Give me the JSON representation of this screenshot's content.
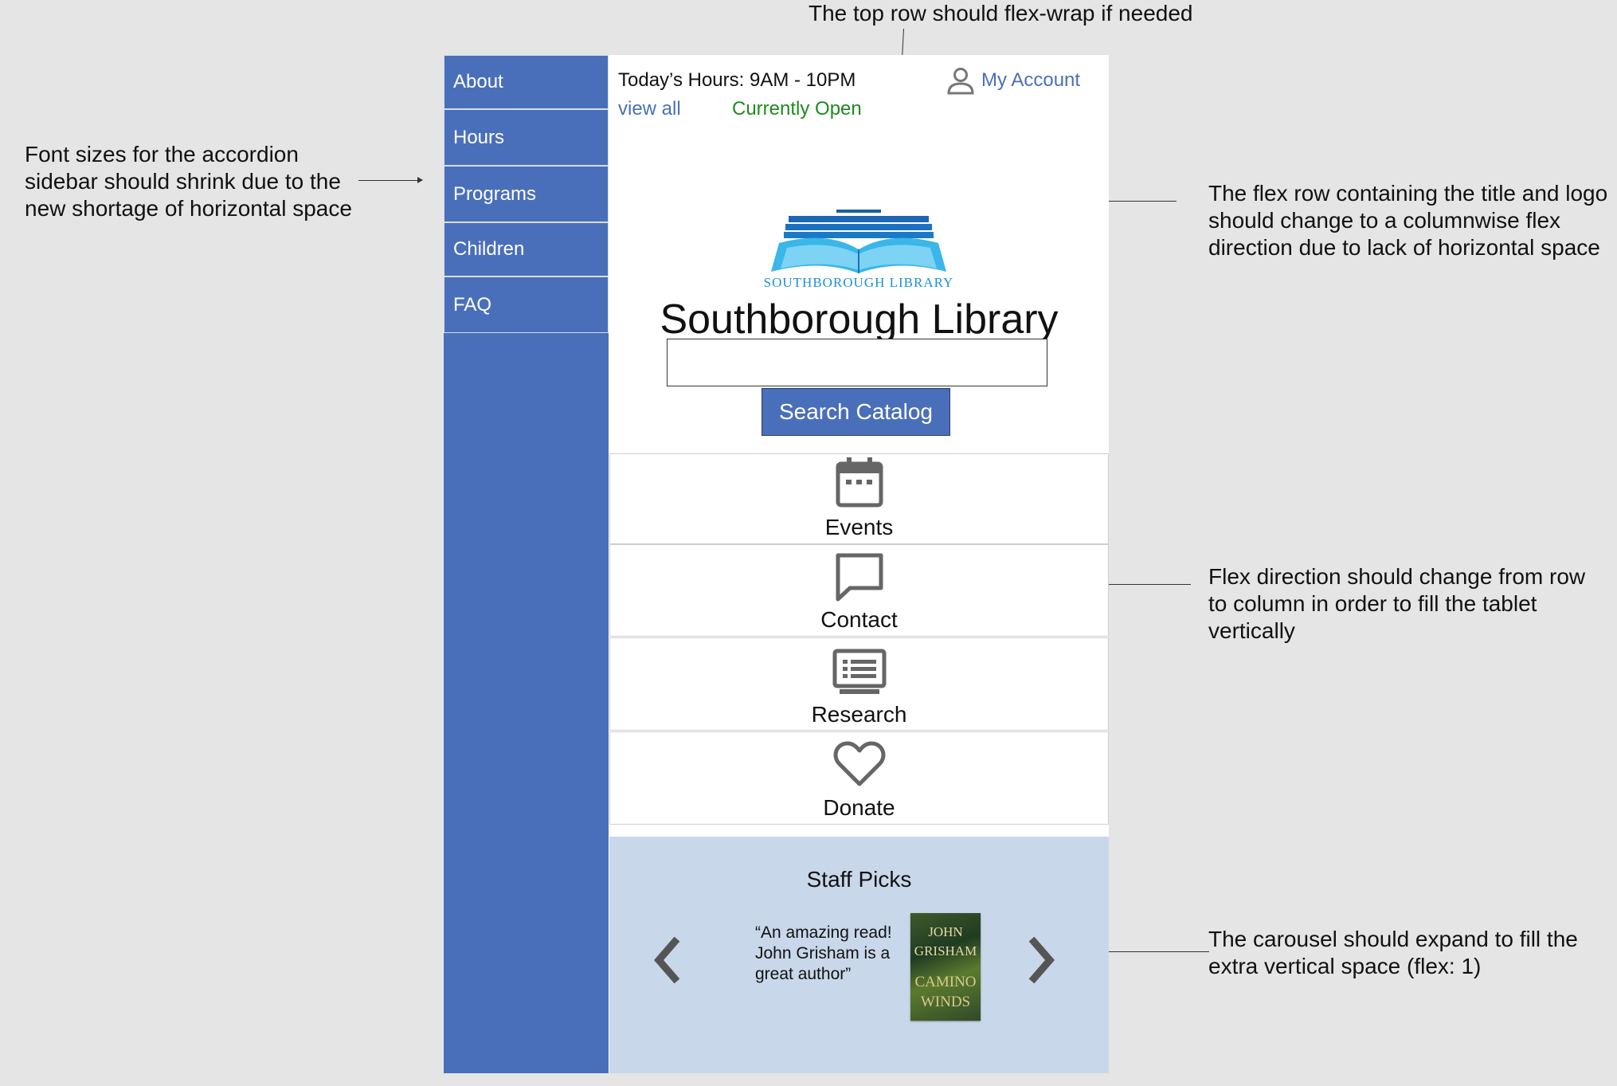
{
  "annotations": {
    "top": "The top row should flex-wrap if needed",
    "sidebar_lines": [
      "Font sizes for the accordion",
      "sidebar should shrink due to the",
      "new shortage of horizontal space"
    ],
    "title_logo_lines": [
      "The flex row containing the title and logo",
      "should change to a columnwise flex",
      "direction due to lack of horizontal space"
    ],
    "tiles_lines": [
      "Flex direction should change from row",
      "to column in order to fill the tablet",
      "vertically"
    ],
    "carousel_lines": [
      "The carousel should expand to fill the",
      "extra vertical space (flex: 1)"
    ]
  },
  "sidebar": {
    "items": [
      {
        "label": "About"
      },
      {
        "label": "Hours"
      },
      {
        "label": "Programs"
      },
      {
        "label": "Children"
      },
      {
        "label": "FAQ"
      }
    ]
  },
  "header": {
    "hours": "Today’s Hours: 9AM - 10PM",
    "view_all": "view all",
    "status": "Currently Open",
    "account": "My Account"
  },
  "brand": {
    "logo_text": "SOUTHBOROUGH LIBRARY",
    "title": "Southborough Library"
  },
  "search": {
    "value": "",
    "button": "Search Catalog"
  },
  "tiles": [
    {
      "label": "Events",
      "icon": "calendar-icon"
    },
    {
      "label": "Contact",
      "icon": "chat-bubble-icon"
    },
    {
      "label": "Research",
      "icon": "monitor-list-icon"
    },
    {
      "label": "Donate",
      "icon": "heart-icon"
    }
  ],
  "carousel": {
    "title": "Staff Picks",
    "quote_lines": [
      "“An amazing read!",
      "John Grisham is a",
      "great author”"
    ],
    "book": {
      "author_lines": [
        "JOHN",
        "GRISHAM"
      ],
      "title_lines": [
        "CAMINO",
        "WINDS"
      ]
    }
  },
  "colors": {
    "sidebar": "#4a6fba",
    "link": "#4a6fba",
    "status_open": "#1e8a1e",
    "carousel_bg": "#c9d7ea",
    "page_bg": "#e5e5e5"
  }
}
